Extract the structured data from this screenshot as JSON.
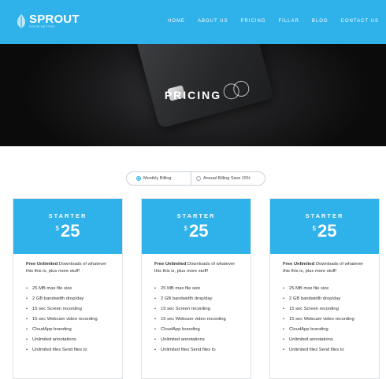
{
  "header": {
    "logo_name": "SPROUT",
    "logo_tagline": "GROW BETTER",
    "nav": [
      "HOME",
      "ABOUT US",
      "PRICING",
      "FILLAR",
      "BLOG",
      "CONTACT US"
    ]
  },
  "hero": {
    "title": "PRICING"
  },
  "billing": {
    "monthly": "Monthly Billing",
    "annual": "Annual Billing Save 15%",
    "selected": "monthly"
  },
  "plans": [
    {
      "name": "STARTER",
      "currency": "$",
      "price": "25",
      "intro_bold": "Free Unlimited",
      "intro_rest": " Downloads of whatever this this is, plus more stuff!",
      "features": [
        "25 MB max file size",
        "2 GB bandwidth drop/day",
        "15 sec Screen recording",
        "15 sec Webcam video recording",
        "CloudApp branding",
        "Unlimited annotations",
        "Unlimited files Send files to"
      ]
    },
    {
      "name": "STARTER",
      "currency": "$",
      "price": "25",
      "intro_bold": "Free Unlimited",
      "intro_rest": " Downloads of whatever this this is, plus more stuff!",
      "features": [
        "25 MB max file size",
        "2 GB bandwidth drop/day",
        "15 sec Screen recording",
        "15 sec Webcam video recording",
        "CloudApp branding",
        "Unlimited annotations",
        "Unlimited files Send files to"
      ]
    },
    {
      "name": "STARTER",
      "currency": "$",
      "price": "25",
      "intro_bold": "Free Unlimited",
      "intro_rest": " Downloads of whatever this this is, plus more stuff!",
      "features": [
        "25 MB max file size",
        "2 GB bandwidth drop/day",
        "15 sec Screen recording",
        "15 sec Webcam video recording",
        "CloudApp branding",
        "Unlimited annotations",
        "Unlimited files Send files to"
      ]
    }
  ],
  "colors": {
    "accent": "#2fb1ea",
    "hero_bg": "#141414"
  },
  "icons": {
    "logo": "leaf-logo-icon",
    "radio_on": "radio-checked-icon",
    "radio_off": "radio-unchecked-icon",
    "bullet": "bullet-dot-icon"
  }
}
